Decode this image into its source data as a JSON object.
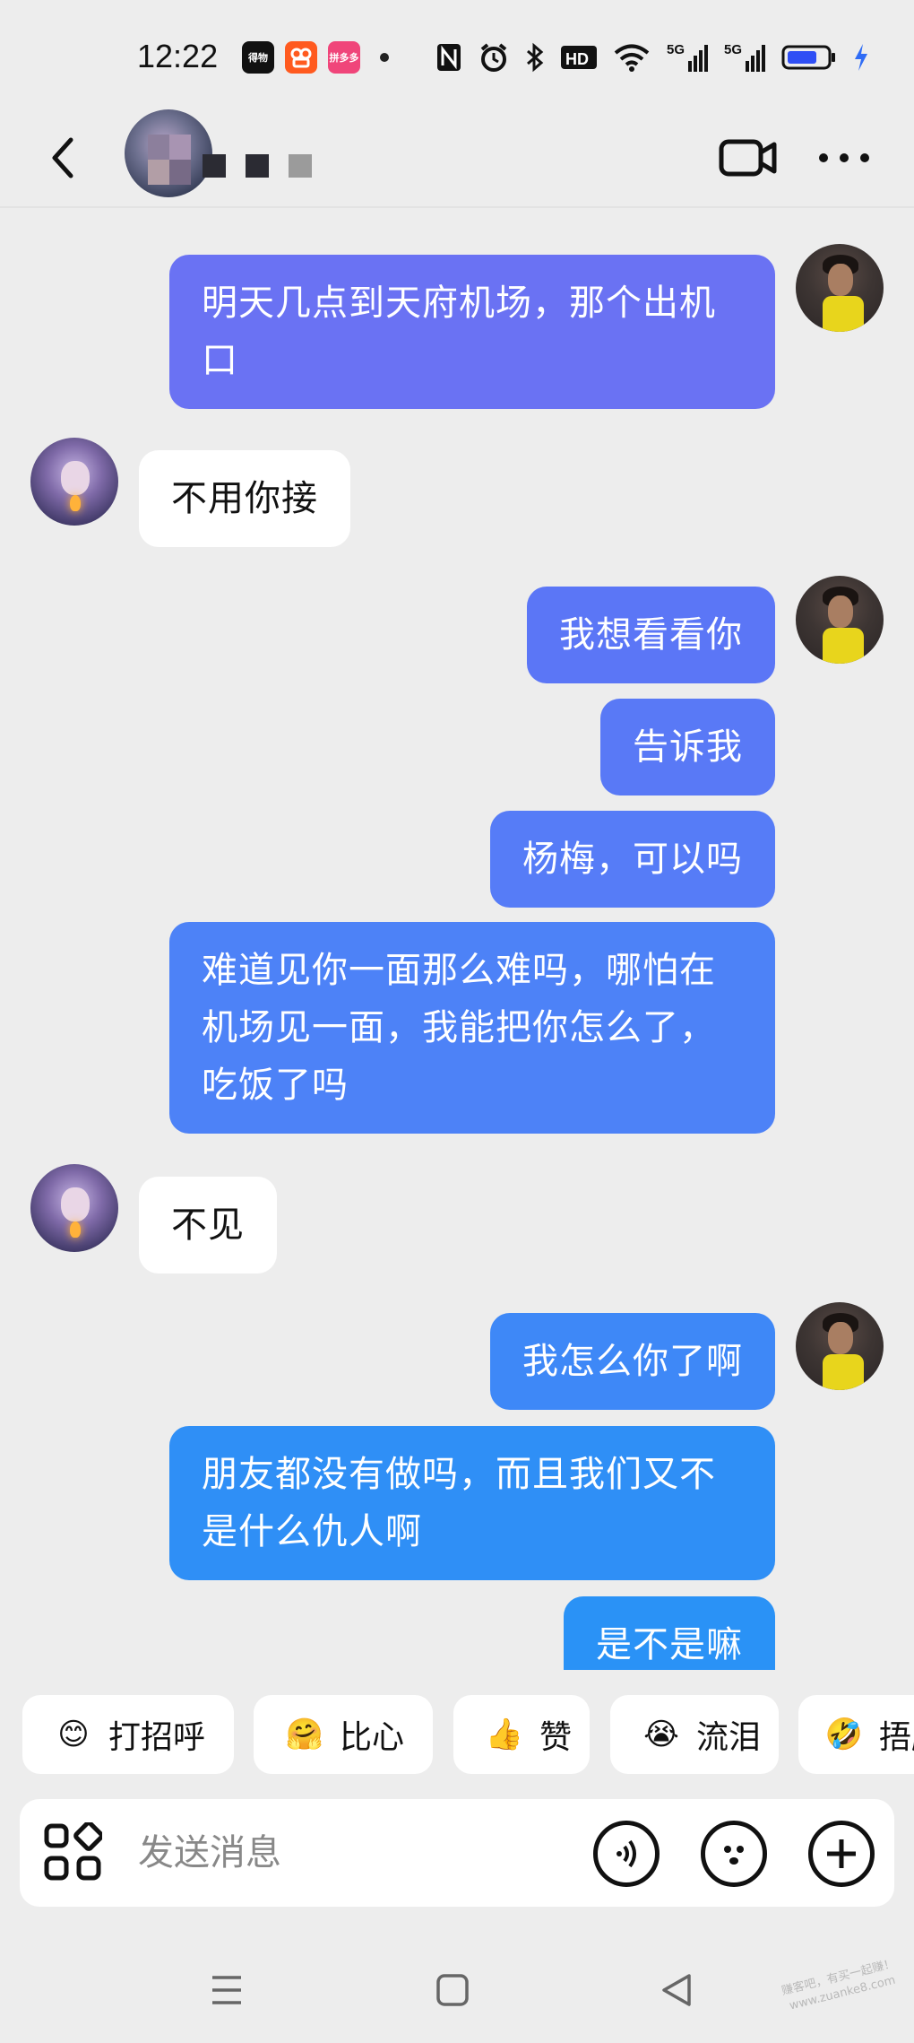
{
  "status_bar": {
    "time": "12:22",
    "apps": [
      {
        "icon": "dewu-app-icon",
        "label": "得物",
        "color": "#111111"
      },
      {
        "icon": "kuaishou-app-icon",
        "label": "",
        "color": "#ff5a1f"
      },
      {
        "icon": "pinduoduo-app-icon",
        "label": "拼多多",
        "color": "#f0457a"
      }
    ],
    "hd_label": "HD",
    "net1": "5G",
    "net2": "5G",
    "battery_color": "#2f4ff5"
  },
  "header": {
    "back": "back",
    "contact_avatar": "blurred-avatar"
  },
  "messages": [
    {
      "from": "me",
      "text_lines": [
        "明天几点到天府机场，那个出机",
        "口"
      ],
      "color": "#6a72f3"
    },
    {
      "from": "her",
      "text_lines": [
        "不用你接"
      ]
    },
    {
      "from": "me",
      "text_lines": [
        "我想看看你"
      ],
      "color": "#5b76f6"
    },
    {
      "from": "me",
      "text_lines": [
        "告诉我"
      ],
      "color": "#5979f6"
    },
    {
      "from": "me",
      "text_lines": [
        "杨梅，可以吗"
      ],
      "color": "#567cf7"
    },
    {
      "from": "me",
      "text_lines": [
        "难道见你一面那么难吗，哪怕在",
        "机场见一面，我能把你怎么了，",
        "吃饭了吗"
      ],
      "color": "#4d82f7"
    },
    {
      "from": "her",
      "text_lines": [
        "不见"
      ]
    },
    {
      "from": "me",
      "text_lines": [
        "我怎么你了啊"
      ],
      "color": "#3e88f7"
    },
    {
      "from": "me",
      "text_lines": [
        "朋友都没有做吗，而且我们又不",
        "是什么仇人啊"
      ],
      "color": "#2f8ff6"
    },
    {
      "from": "me",
      "text_lines": [
        "是不是嘛"
      ],
      "color": "#2a92f6"
    }
  ],
  "quick_replies": [
    {
      "label": "打招呼",
      "icon": "wave-emoji-icon",
      "emoji": "😊"
    },
    {
      "label": "比心",
      "icon": "heart-hands-emoji-icon",
      "emoji": "🤗"
    },
    {
      "label": "赞",
      "icon": "thumbs-up-emoji-icon",
      "emoji": "👍"
    },
    {
      "label": "流泪",
      "icon": "crying-emoji-icon",
      "emoji": "😭"
    },
    {
      "label": "捂脸",
      "icon": "facepalm-emoji-icon",
      "emoji": "🤣"
    }
  ],
  "input": {
    "placeholder": "发送消息"
  },
  "watermark": {
    "line1": "赚客吧，有买一起赚！",
    "line2": "www.zuanke8.com"
  }
}
